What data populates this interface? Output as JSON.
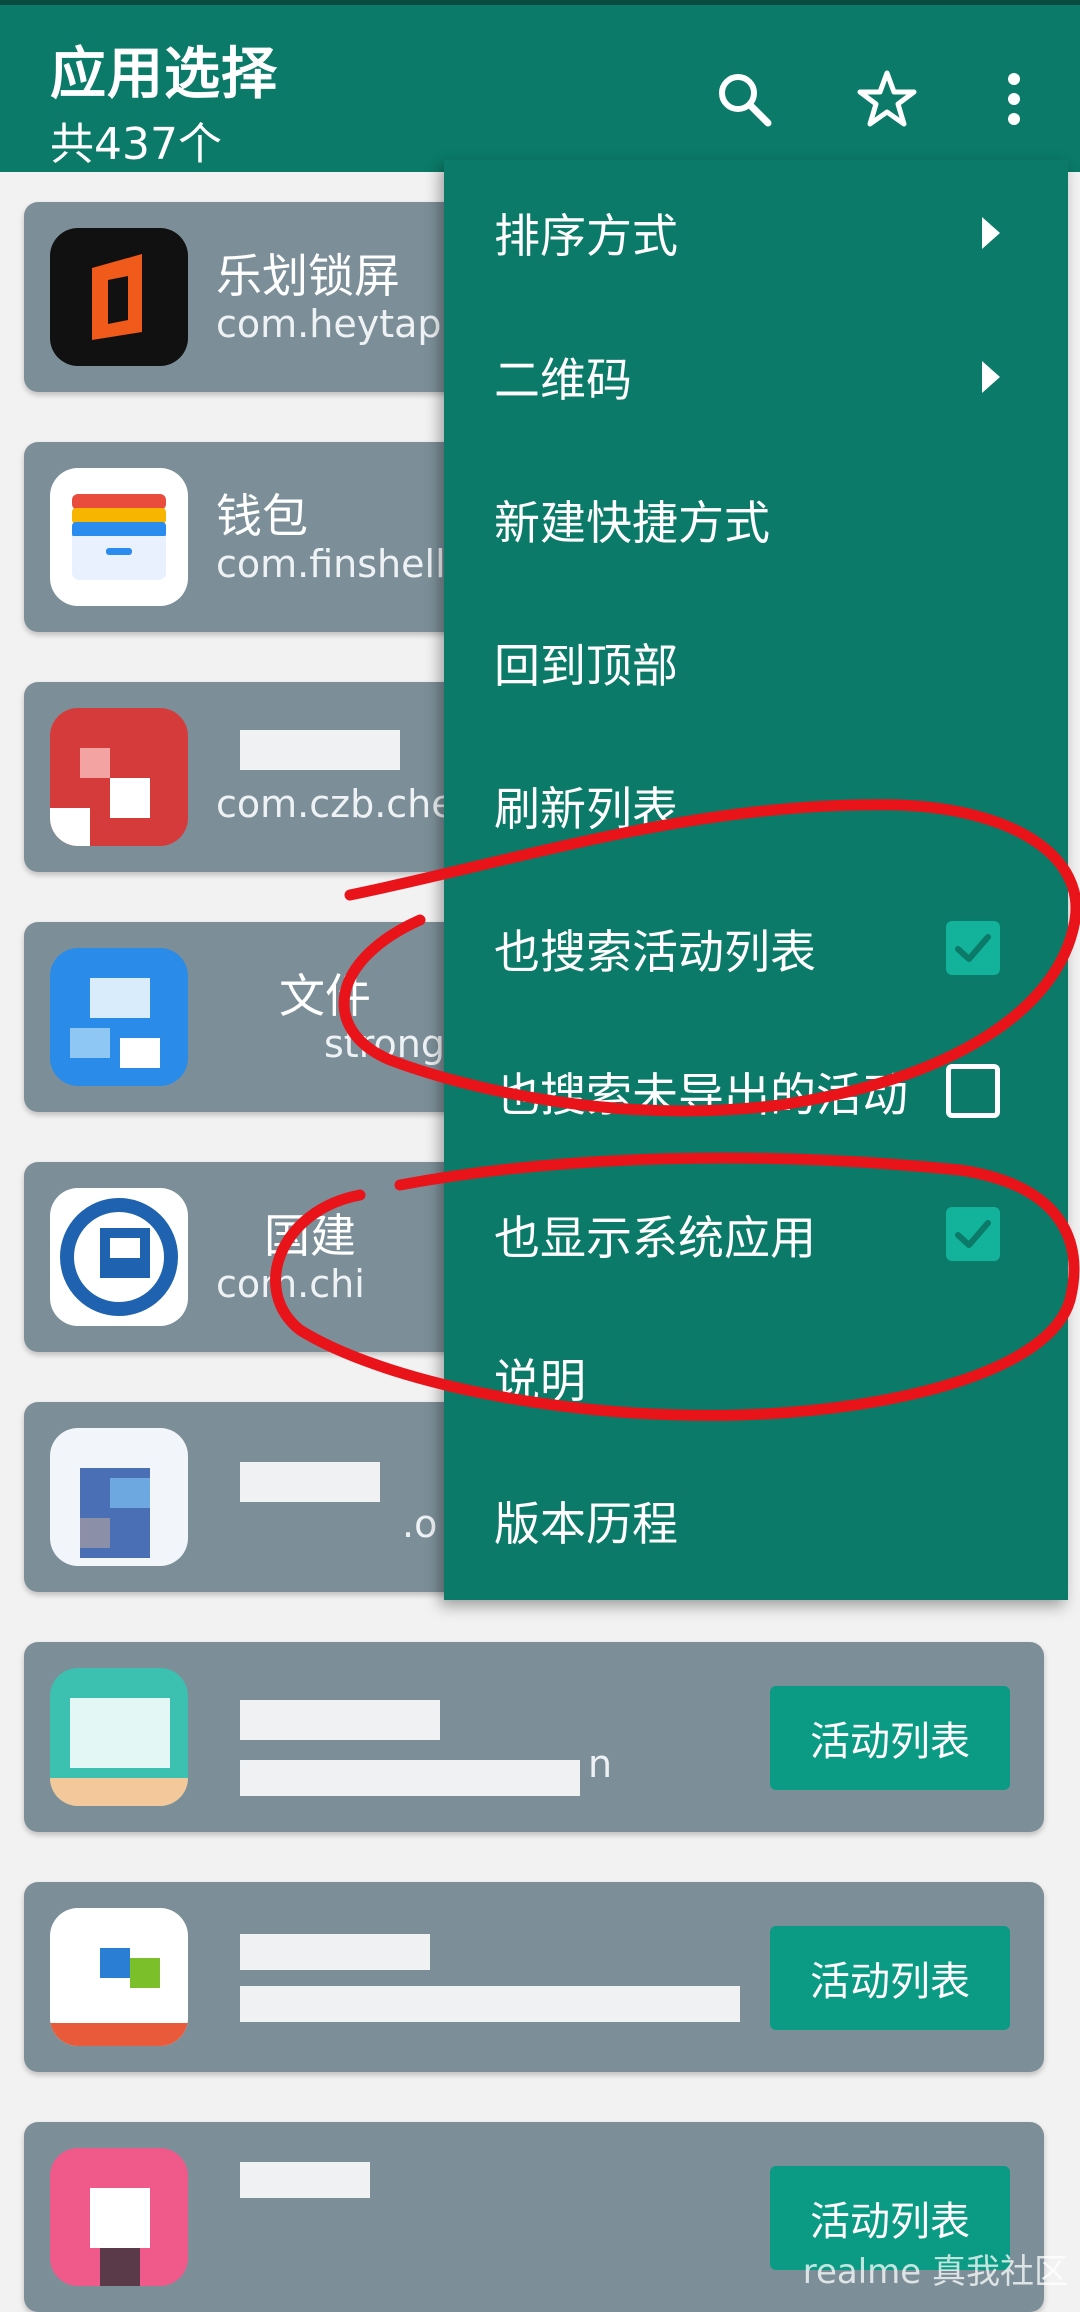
{
  "appbar": {
    "title": "应用选择",
    "subtitle": "共437个"
  },
  "apps": [
    {
      "name": "乐划锁屏",
      "pkg": "com.heytap."
    },
    {
      "name": "钱包",
      "pkg": "com.finshell"
    },
    {
      "name": "",
      "pkg": "com.czb.che"
    },
    {
      "name": "文件",
      "pkg": "strong"
    },
    {
      "name": "国建",
      "pkg": "com.chi"
    },
    {
      "name": "",
      "pkg": ".o"
    },
    {
      "name": "",
      "pkg": "n",
      "button": "活动列表"
    },
    {
      "name": "",
      "pkg": "",
      "button": "活动列表"
    },
    {
      "name": "",
      "pkg": "",
      "button": "活动列表"
    }
  ],
  "menu": {
    "items": [
      {
        "label": "排序方式",
        "type": "submenu"
      },
      {
        "label": "二维码",
        "type": "submenu"
      },
      {
        "label": "新建快捷方式",
        "type": "plain"
      },
      {
        "label": "回到顶部",
        "type": "plain"
      },
      {
        "label": "刷新列表",
        "type": "plain"
      },
      {
        "label": "也搜索活动列表",
        "type": "checkbox",
        "checked": true
      },
      {
        "label": "也搜索未导出的活动",
        "type": "checkbox",
        "checked": false
      },
      {
        "label": "也显示系统应用",
        "type": "checkbox",
        "checked": true
      },
      {
        "label": "说明",
        "type": "plain"
      },
      {
        "label": "版本历程",
        "type": "plain"
      }
    ]
  },
  "watermark": "realme 真我社区",
  "colors": {
    "appbar": "#0b7a68",
    "card": "#7c8f98",
    "checkbox_on": "#12b39a",
    "action_button": "#0b9a84",
    "annotation": "#e8141a"
  }
}
